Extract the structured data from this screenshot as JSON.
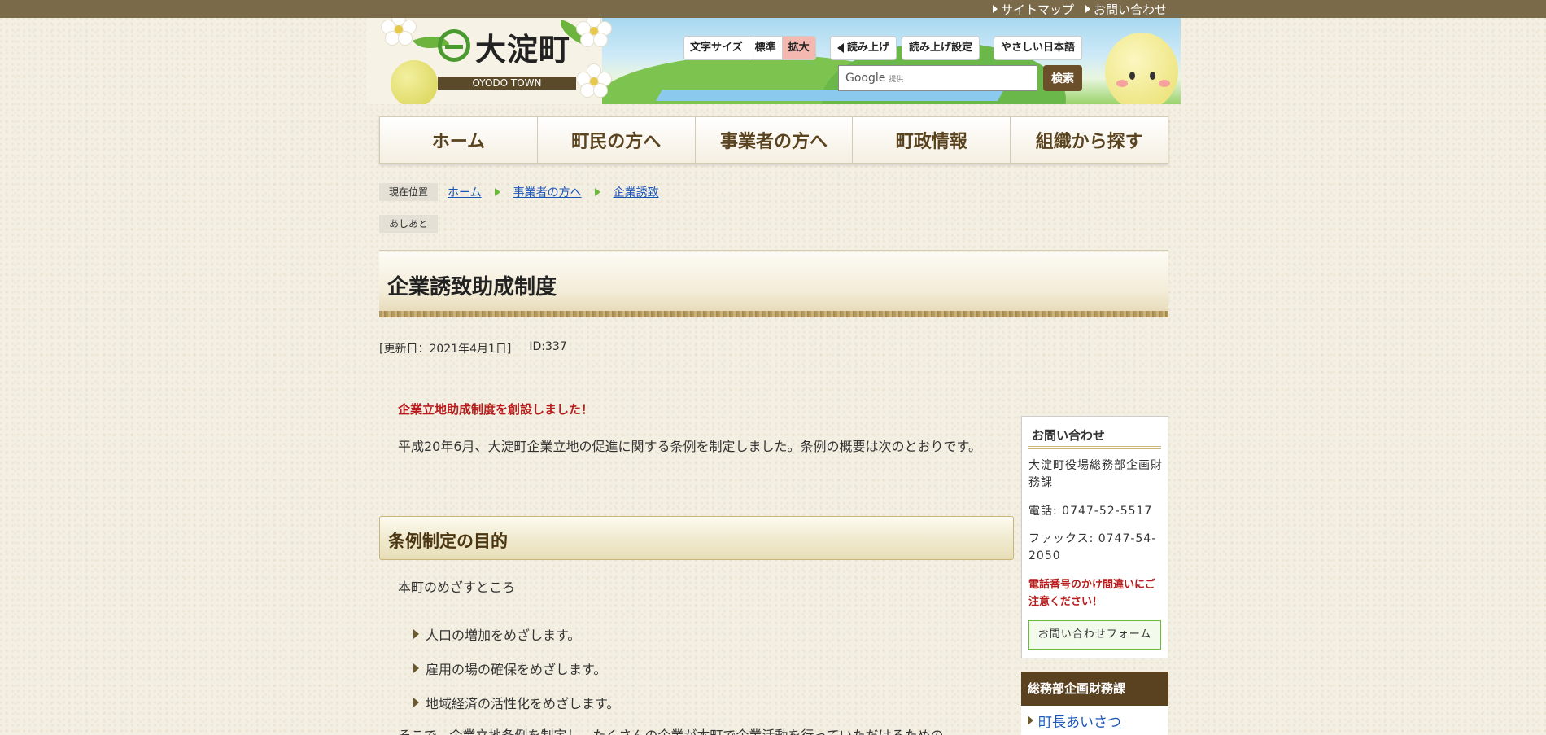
{
  "toplinks": {
    "sitemap": "サイトマップ",
    "contact": "お問い合わせ"
  },
  "header": {
    "logo_text": "大淀町",
    "logo_sub": "OYODO TOWN",
    "fontsize": {
      "label": "文字サイズ",
      "standard": "標準",
      "large": "拡大"
    },
    "read_aloud": "読み上げ",
    "read_settings": "読み上げ設定",
    "easy_japanese": "やさしい日本語",
    "search": {
      "brand": "Google",
      "provided": "提供",
      "button": "検索"
    }
  },
  "nav": [
    "ホーム",
    "町民の方へ",
    "事業者の方へ",
    "町政情報",
    "組織から探す"
  ],
  "breadcrumb": {
    "label": "現在位置",
    "items": [
      "ホーム",
      "事業者の方へ",
      "企業誘致"
    ],
    "ashiato": "あしあと"
  },
  "page": {
    "title": "企業誘致助成制度",
    "updated": "[更新日：2021年4月1日]",
    "id": "ID:337",
    "lead": "企業立地助成制度を創設しました！",
    "intro": "平成20年6月、大淀町企業立地の促進に関する条例を制定しました。条例の概要は次のとおりです。",
    "section1": {
      "heading": "条例制定の目的",
      "sub": "本町のめざすところ",
      "items": [
        "人口の増加をめざします。",
        "雇用の場の確保をめざします。",
        "地域経済の活性化をめざします。"
      ]
    },
    "trailing": "そこで、企業立地条例を制定し、たくさんの企業が本町で企業活動を行っていただけるための"
  },
  "sidebar": {
    "contact": {
      "heading": "お問い合わせ",
      "dept": "大淀町役場総務部企画財務課",
      "phone": "電話: 0747-52-5517",
      "fax": "ファックス: 0747-54-2050",
      "warning": "電話番号のかけ間違いにご注意ください！",
      "form_button": "お問い合わせフォーム"
    },
    "dept_heading": "総務部企画財務課",
    "dept_links": [
      "町長あいさつ"
    ]
  }
}
